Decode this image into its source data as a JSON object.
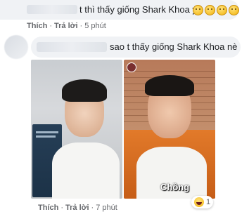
{
  "comments": [
    {
      "text": "t thì thấy giống Shark Khoa ý",
      "emoji_icons": [
        "grinning-emoji",
        "grinning-emoji",
        "grinning-emoji",
        "grinning-emoji"
      ],
      "actions": {
        "like": "Thích",
        "reply": "Trả lời",
        "time": "5 phút"
      }
    },
    {
      "text": "sao t thấy giống Shark Khoa nè",
      "image_caption": "Chồng",
      "actions": {
        "like": "Thích",
        "reply": "Trả lời",
        "time": "7 phút"
      },
      "reaction": {
        "icon": "haha-reaction-icon",
        "count": "1"
      }
    }
  ],
  "colors": {
    "bubble": "#f0f2f5",
    "meta_text": "#65676b",
    "text": "#1c1e21"
  }
}
